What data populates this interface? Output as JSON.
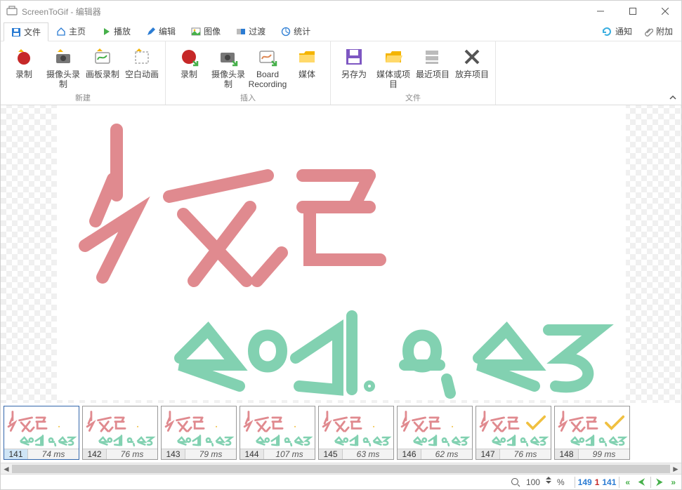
{
  "title": "ScreenToGif - 编辑器",
  "tabs": {
    "file": "文件",
    "home": "主页",
    "play": "播放",
    "edit": "编辑",
    "image": "图像",
    "transition": "过渡",
    "stats": "统计"
  },
  "top_right": {
    "notify": "通知",
    "extras": "附加"
  },
  "ribbon": {
    "new_group": "新建",
    "insert_group": "插入",
    "file_group": "文件",
    "record": "录制",
    "webcam_record": "摄像头录制",
    "board_record": "画板录制",
    "blank": "空白动画",
    "ins_record": "录制",
    "ins_webcam": "摄像头录制",
    "ins_board": "Board Recording",
    "ins_media": "媒体",
    "save_as": "另存为",
    "media_project": "媒体或项目",
    "recent": "最近项目",
    "discard": "放弃项目"
  },
  "status": {
    "zoom_label": "100",
    "percent": "%",
    "pos1": "149",
    "pos2": "1",
    "pos3": "141"
  },
  "frames": [
    {
      "num": "141",
      "ms": "74 ms"
    },
    {
      "num": "142",
      "ms": "76 ms"
    },
    {
      "num": "143",
      "ms": "79 ms"
    },
    {
      "num": "144",
      "ms": "107 ms"
    },
    {
      "num": "145",
      "ms": "63 ms"
    },
    {
      "num": "146",
      "ms": "62 ms"
    },
    {
      "num": "147",
      "ms": "76 ms"
    },
    {
      "num": "148",
      "ms": "99 ms"
    }
  ]
}
